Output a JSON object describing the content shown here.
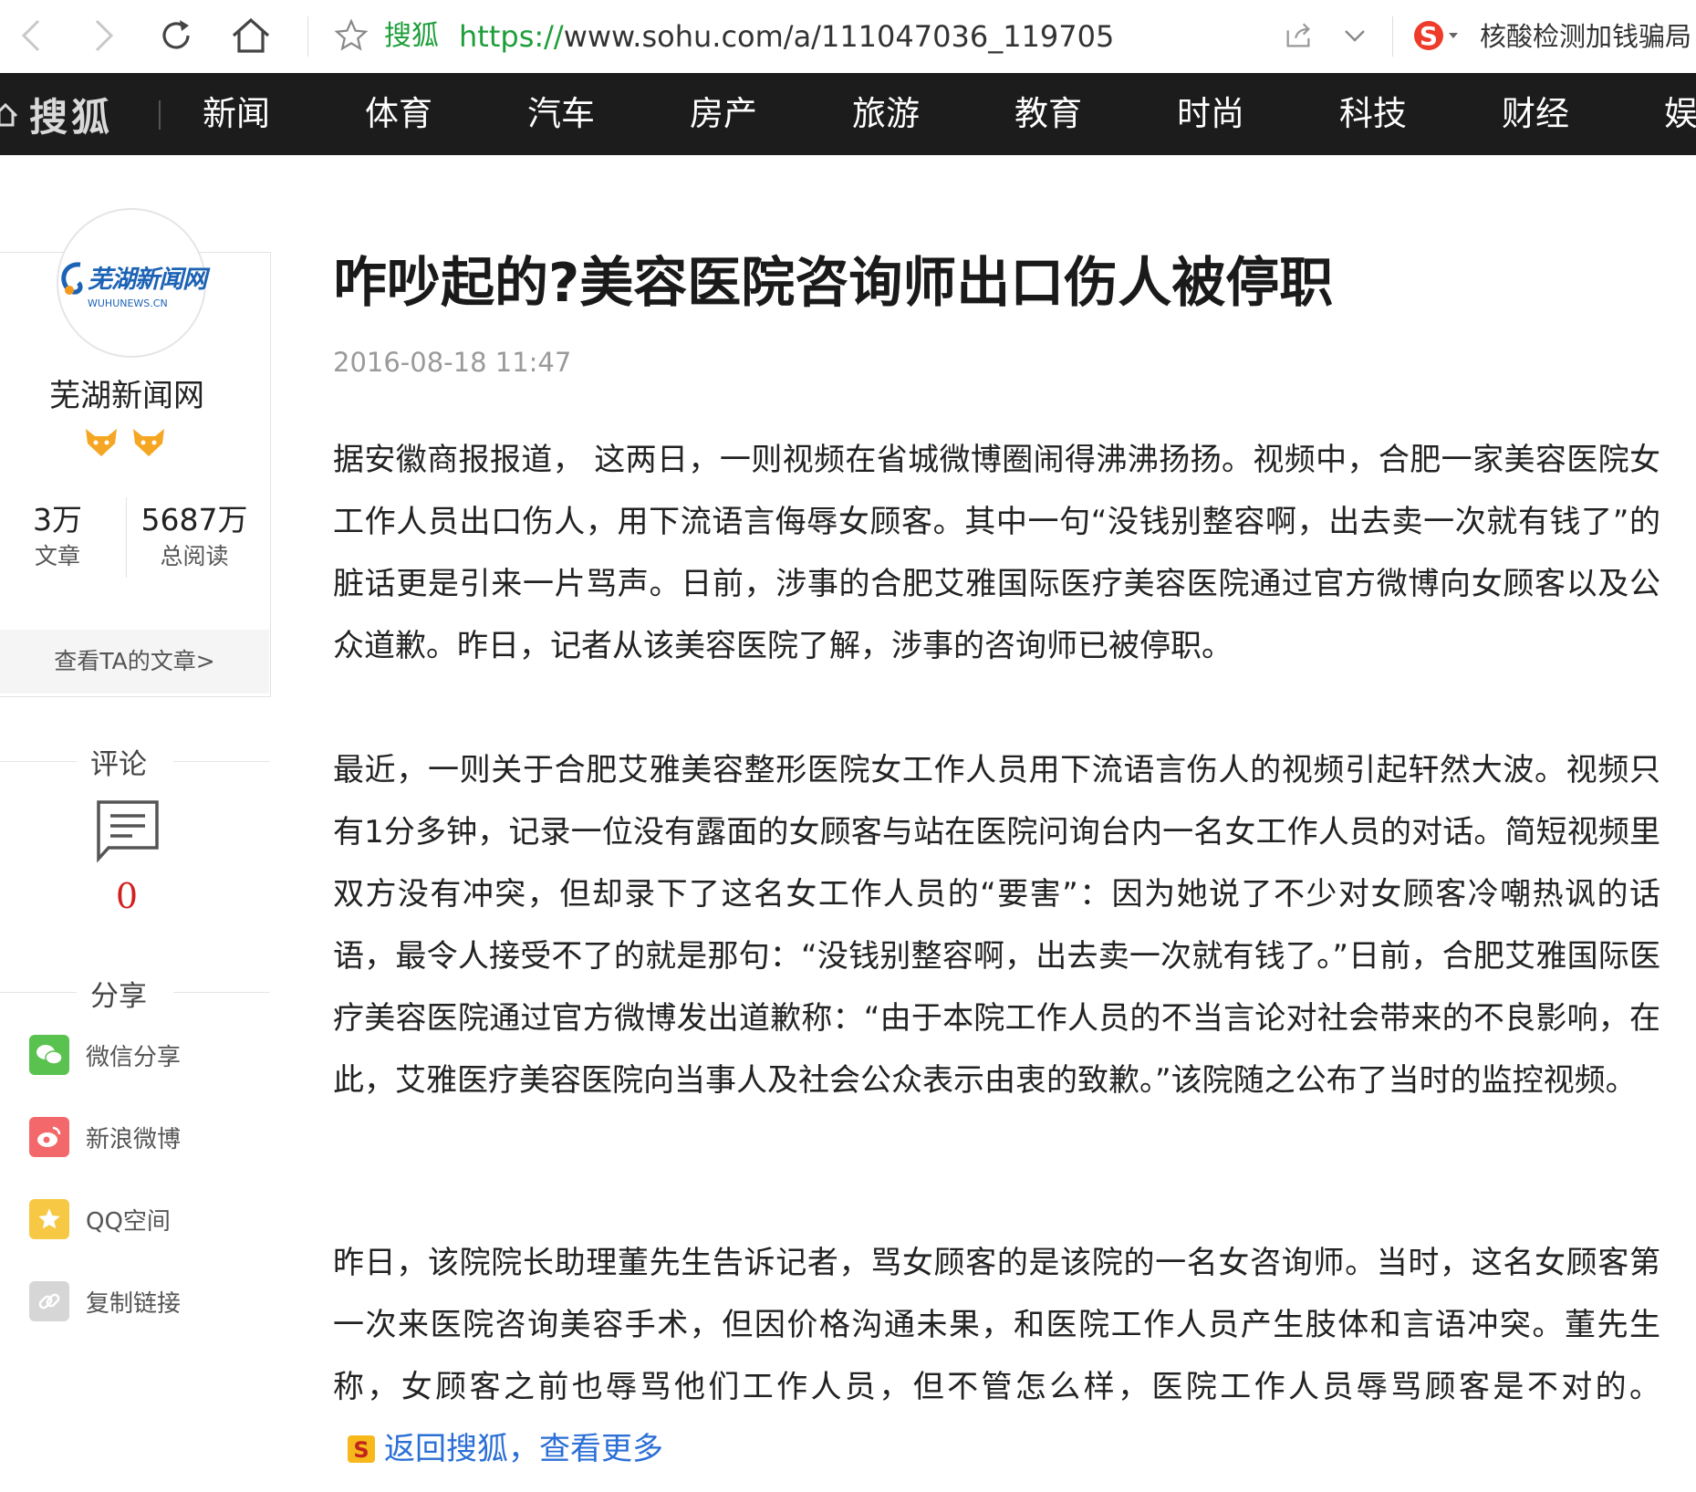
{
  "browser": {
    "site_name": "搜狐",
    "url_protocol": "https://",
    "url_rest": "www.sohu.com/a/111047036_119705",
    "hot_search": "核酸检测加钱骗局"
  },
  "nav": {
    "brand": "搜狐",
    "items": [
      "新闻",
      "体育",
      "汽车",
      "房产",
      "旅游",
      "教育",
      "时尚",
      "科技",
      "财经",
      "娱"
    ]
  },
  "author": {
    "logo_cn": "芜湖新闻网",
    "logo_en": "WUHUNEWS.CN",
    "name": "芜湖新闻网",
    "articles_count": "3万",
    "articles_label": "文章",
    "reads_count": "5687万",
    "reads_label": "总阅读",
    "view_more": "查看TA的文章>"
  },
  "comments": {
    "title": "评论",
    "count": "0"
  },
  "share": {
    "title": "分享",
    "items": [
      {
        "label": "微信分享",
        "color": "#5ac24f"
      },
      {
        "label": "新浪微博",
        "color": "#f2686b"
      },
      {
        "label": "QQ空间",
        "color": "#f7c843"
      },
      {
        "label": "复制链接",
        "color": "#d6d6d6"
      }
    ]
  },
  "article": {
    "title": "咋吵起的?美容医院咨询师出口伤人被停职",
    "date": "2016-08-18 11:47",
    "paragraphs": [
      "据安徽商报报道， 这两日，一则视频在省城微博圈闹得沸沸扬扬。视频中，合肥一家美容医院女工作人员出口伤人，用下流语言侮辱女顾客。其中一句“没钱别整容啊，出去卖一次就有钱了”的脏话更是引来一片骂声。日前，涉事的合肥艾雅国际医疗美容医院通过官方微博向女顾客以及公众道歉。昨日，记者从该美容医院了解，涉事的咨询师已被停职。",
      "最近，一则关于合肥艾雅美容整形医院女工作人员用下流语言伤人的视频引起轩然大波。视频只有1分多钟，记录一位没有露面的女顾客与站在医院问询台内一名女工作人员的对话。简短视频里双方没有冲突，但却录下了这名女工作人员的“要害”：因为她说了不少对女顾客冷嘲热讽的话语，最令人接受不了的就是那句：“没钱别整容啊，出去卖一次就有钱了。”日前，合肥艾雅国际医疗美容医院通过官方微博发出道歉称：“由于本院工作人员的不当言论对社会带来的不良影响，在此，艾雅医疗美容医院向当事人及社会公众表示由衷的致歉。”该院随之公布了当时的监控视频。",
      "昨日，该院院长助理董先生告诉记者，骂女顾客的是该院的一名女咨询师。当时，这名女顾客第一次来医院咨询美容手术，但因价格沟通未果，和医院工作人员产生肢体和言语冲突。董先生称，女顾客之前也辱骂他们工作人员，但不管怎么样，医院工作人员辱骂顾客是不对的。"
    ],
    "back_link": "返回搜狐，查看更多"
  }
}
